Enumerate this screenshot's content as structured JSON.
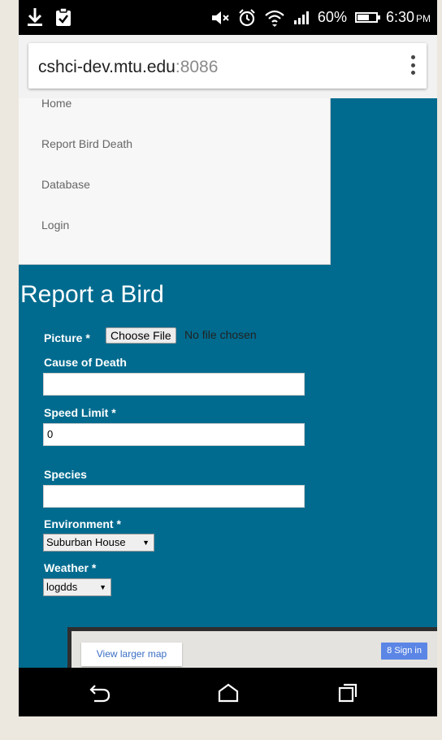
{
  "status_bar": {
    "battery_percent": "60%",
    "time": "6:30",
    "ampm": "PM"
  },
  "browser": {
    "url_host": "cshci-dev.mtu.edu",
    "url_port": ":8086"
  },
  "nav": {
    "items": [
      {
        "label": "Home"
      },
      {
        "label": "Report Bird Death"
      },
      {
        "label": "Database"
      },
      {
        "label": "Login"
      }
    ]
  },
  "form": {
    "title": "Report a Bird",
    "picture_label": "Picture *",
    "choose_file_label": "Choose File",
    "file_status": "No file chosen",
    "cause_label": "Cause of Death",
    "cause_value": "",
    "speed_label": "Speed Limit *",
    "speed_value": "0",
    "species_label": "Species",
    "species_value": "",
    "environment_label": "Environment *",
    "environment_value": "Suburban House",
    "weather_label": "Weather *",
    "weather_value": "logdds"
  },
  "map": {
    "view_larger_label": "View larger map",
    "sign_in_label": "Sign in"
  },
  "colors": {
    "page_bg": "#006b8f",
    "map_link": "#3a6fc4",
    "sign_in_bg": "#5b86e5"
  }
}
